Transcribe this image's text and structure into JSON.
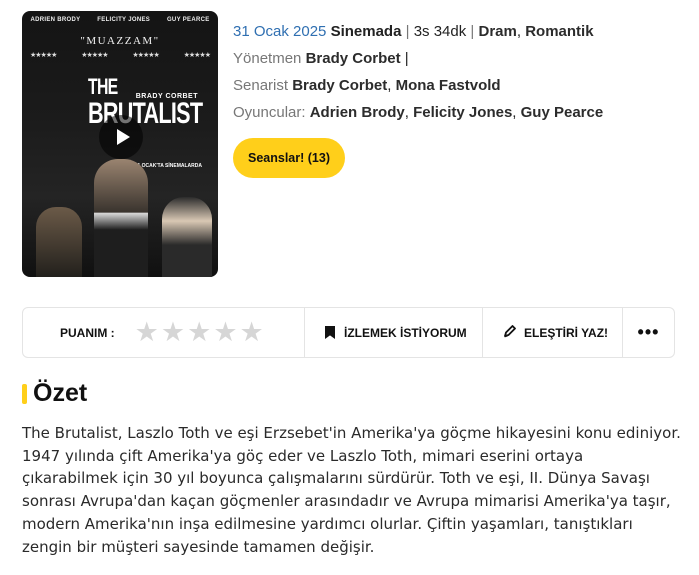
{
  "poster": {
    "actors": [
      "ADRIEN BRODY",
      "FELICITY JONES",
      "GUY PEARCE"
    ],
    "quote": "\"MUAZZAM\"",
    "title_line1": "THE",
    "title_line2": "BRUTALIST",
    "director_credit": "BRADY CORBET",
    "release_note": "31 OCAK'TA SİNEMALARDA"
  },
  "movie": {
    "release_date": "31 Ocak 2025",
    "status": "Sinemada",
    "duration": "3s 34dk",
    "genres": [
      "Dram",
      "Romantik"
    ],
    "director_label": "Yönetmen",
    "director": "Brady Corbet",
    "writer_label": "Senarist",
    "writers": [
      "Brady Corbet",
      "Mona Fastvold"
    ],
    "cast_label": "Oyuncular:",
    "cast": [
      "Adrien Brody",
      "Felicity Jones",
      "Guy Pearce"
    ]
  },
  "sessions_button": "Seanslar! (13)",
  "rating_bar": {
    "label": "PUANIM :",
    "stars_total": 5,
    "stars_filled": 0,
    "watchlist_label": "İZLEMEK İSTİYORUM",
    "review_label": "ELEŞTİRİ YAZ!",
    "more_label": "•••"
  },
  "summary": {
    "title": "Özet",
    "text": "The Brutalist, Laszlo Toth ve eşi Erzsebet'in Amerika'ya göçme hikayesini konu ediniyor. 1947 yılında çift Amerika'ya göç eder ve Laszlo Toth, mimari eserini ortaya çıkarabilmek için 30 yıl boyunca çalışmalarını sürdürür. Toth ve eşi, II. Dünya Savaşı sonrası Avrupa'dan kaçan göçmenler arasındadır ve Avrupa mimarisi Amerika'ya taşır, modern Amerika'nın inşa edilmesine yardımcı olurlar. Çiftin yaşamları, tanıştıkları zengin bir müşteri sayesinde tamamen değişir."
  },
  "colors": {
    "accent": "#ffcf1a",
    "date_link": "#2f6fb1"
  }
}
